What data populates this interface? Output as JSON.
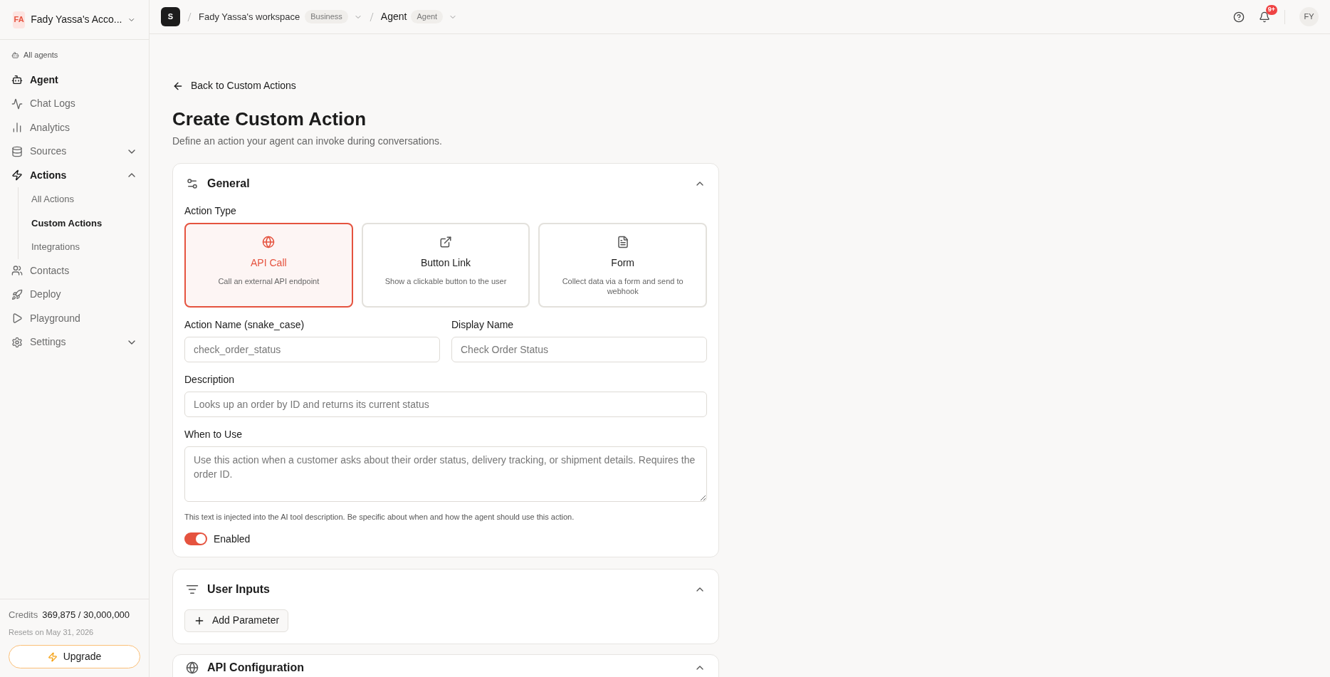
{
  "account": {
    "initials": "FA",
    "name": "Fady Yassa's Acco..."
  },
  "sidebar": {
    "back_link": "All agents",
    "items": [
      {
        "label": "Agent",
        "selected": true
      },
      {
        "label": "Chat Logs",
        "selected": false
      },
      {
        "label": "Analytics",
        "selected": false
      },
      {
        "label": "Sources",
        "selected": false,
        "expanded": false
      },
      {
        "label": "Actions",
        "selected": true,
        "expanded": true,
        "children": [
          {
            "label": "All Actions",
            "selected": false
          },
          {
            "label": "Custom Actions",
            "selected": true
          },
          {
            "label": "Integrations",
            "selected": false
          }
        ]
      },
      {
        "label": "Contacts",
        "selected": false
      },
      {
        "label": "Deploy",
        "selected": false
      },
      {
        "label": "Playground",
        "selected": false
      },
      {
        "label": "Settings",
        "selected": false,
        "expanded": false
      }
    ],
    "credits_label": "Credits",
    "credits_value": "369,875 / 30,000,000",
    "resets": "Resets on May 31, 2026",
    "upgrade": "Upgrade"
  },
  "topbar": {
    "logo": "S",
    "workspace": "Fady Yassa's workspace",
    "workspace_badge": "Business",
    "agent": "Agent",
    "agent_badge": "Agent",
    "notifications_badge": "9+",
    "avatar": "FY"
  },
  "page": {
    "back": "Back to Custom Actions",
    "title": "Create Custom Action",
    "subtitle": "Define an action your agent can invoke during conversations."
  },
  "general": {
    "title": "General",
    "expanded": true,
    "action_type_label": "Action Type",
    "action_types": [
      {
        "title": "API Call",
        "description": "Call an external API endpoint",
        "selected": true
      },
      {
        "title": "Button Link",
        "description": "Show a clickable button to the user",
        "selected": false
      },
      {
        "title": "Form",
        "description": "Collect data via a form and send to webhook",
        "selected": false
      }
    ],
    "action_name": {
      "label": "Action Name (snake_case)",
      "placeholder": "check_order_status"
    },
    "display_name": {
      "label": "Display Name",
      "placeholder": "Check Order Status"
    },
    "description": {
      "label": "Description",
      "placeholder": "Looks up an order by ID and returns its current status"
    },
    "when_to_use": {
      "label": "When to Use",
      "placeholder": "Use this action when a customer asks about their order status, delivery tracking, or shipment details. Requires the order ID.",
      "hint": "This text is injected into the AI tool description. Be specific about when and how the agent should use this action."
    },
    "enabled": {
      "label": "Enabled",
      "on": true
    }
  },
  "user_inputs": {
    "title": "User Inputs",
    "expanded": true,
    "add_button": "Add Parameter"
  },
  "api_configuration": {
    "title": "API Configuration",
    "expanded": true
  }
}
